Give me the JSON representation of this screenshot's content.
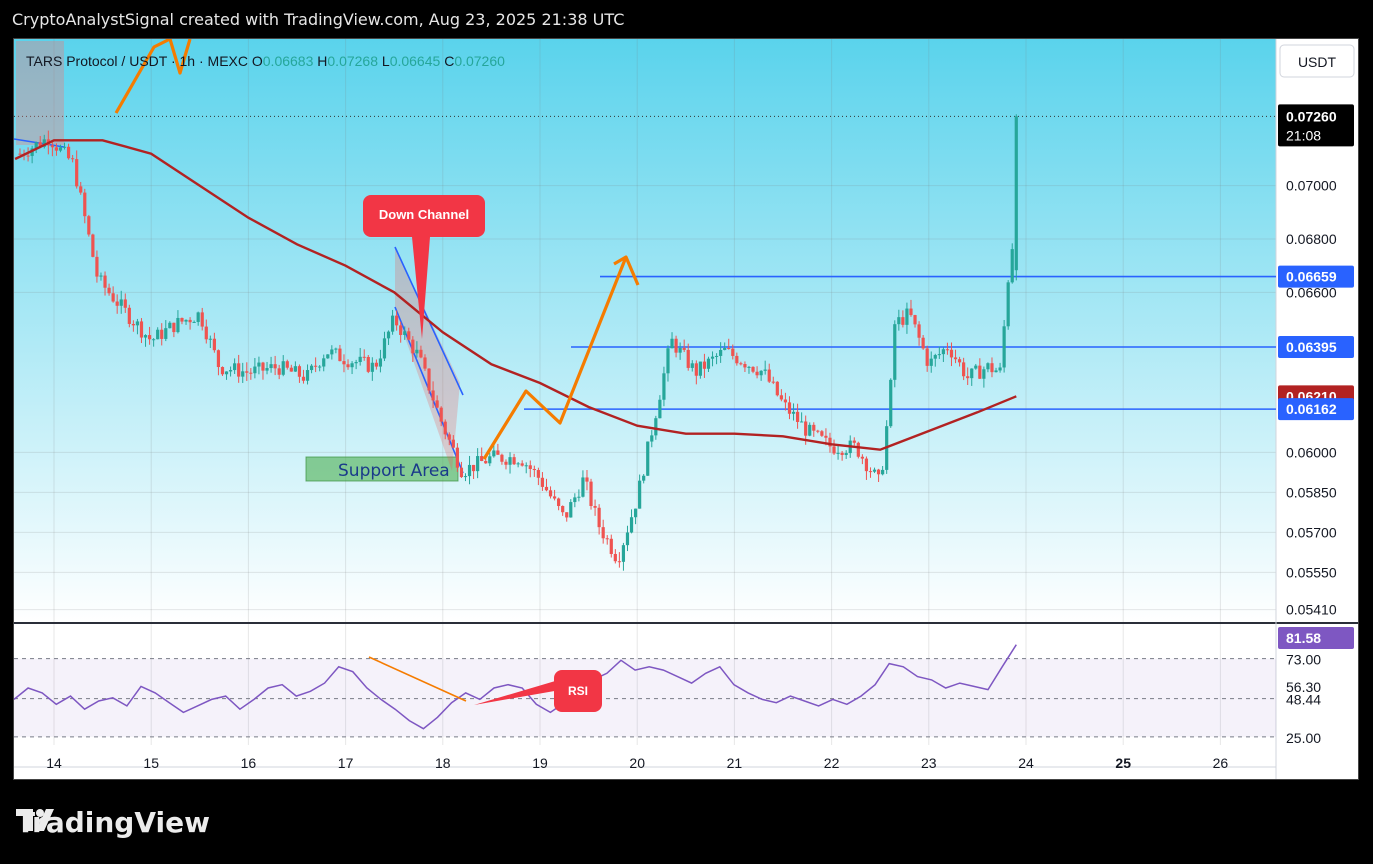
{
  "header": {
    "text": "CryptoAnalystSignal created with TradingView.com, Aug 23, 2025 21:38 UTC"
  },
  "brand": {
    "logo_text": "TradingView"
  },
  "legend": {
    "symbol": "TARS Protocol / USDT · 1h · MEXC",
    "o_label": "O",
    "o_value": "0.06683",
    "h_label": "H",
    "h_value": "0.07268",
    "l_label": "L",
    "l_value": "0.06645",
    "c_label": "C",
    "c_value": "0.07260"
  },
  "currency_button": "USDT",
  "price_labels": {
    "last": "0.07260",
    "countdown": "21:08",
    "line1": "0.06659",
    "line2": "0.06395",
    "ma": "0.06210",
    "line3": "0.06162"
  },
  "rsi_labels": {
    "current": "81.58",
    "upper": "73.00",
    "mid": "56.30",
    "mid2": "48.44",
    "lower": "25.00"
  },
  "annotations": {
    "down_channel": "Down Channel",
    "support_area": "Support Area",
    "rsi": "RSI"
  },
  "colors": {
    "up": "#26a69a",
    "down": "#ef5350",
    "ma": "#b22222",
    "levels": "#2962ff",
    "rsi": "#7e57c2",
    "arrow": "#f57c00",
    "bg_top": "#5ad3ec",
    "bg_bottom": "#ffffff"
  },
  "chart_data": {
    "type": "candlestick",
    "title": "TARS Protocol / USDT · 1h · MEXC",
    "x_ticks": [
      "14",
      "15",
      "16",
      "17",
      "18",
      "19",
      "20",
      "21",
      "22",
      "23",
      "24",
      "25",
      "26"
    ],
    "y_ticks": [
      0.07,
      0.068,
      0.066,
      0.06,
      0.0585,
      0.057,
      0.0555,
      0.0541
    ],
    "ylim": [
      0.0536,
      0.0755
    ],
    "horizontal_levels": [
      0.06659,
      0.06395,
      0.06162
    ],
    "ma_last": 0.0621,
    "last_price": 0.0726,
    "close_path": [
      {
        "x": 13.65,
        "y": 0.0712
      },
      {
        "x": 13.95,
        "y": 0.0718
      },
      {
        "x": 14.2,
        "y": 0.0708
      },
      {
        "x": 14.45,
        "y": 0.0665
      },
      {
        "x": 14.75,
        "y": 0.0652
      },
      {
        "x": 15.0,
        "y": 0.0642
      },
      {
        "x": 15.25,
        "y": 0.0648
      },
      {
        "x": 15.5,
        "y": 0.0652
      },
      {
        "x": 15.7,
        "y": 0.0632
      },
      {
        "x": 16.0,
        "y": 0.063
      },
      {
        "x": 16.3,
        "y": 0.0632
      },
      {
        "x": 16.6,
        "y": 0.0628
      },
      {
        "x": 16.8,
        "y": 0.0638
      },
      {
        "x": 17.0,
        "y": 0.0635
      },
      {
        "x": 17.3,
        "y": 0.0632
      },
      {
        "x": 17.5,
        "y": 0.065
      },
      {
        "x": 17.75,
        "y": 0.0636
      },
      {
        "x": 18.0,
        "y": 0.061
      },
      {
        "x": 18.2,
        "y": 0.0593
      },
      {
        "x": 18.5,
        "y": 0.0598
      },
      {
        "x": 18.8,
        "y": 0.0598
      },
      {
        "x": 19.0,
        "y": 0.059
      },
      {
        "x": 19.25,
        "y": 0.0575
      },
      {
        "x": 19.45,
        "y": 0.059
      },
      {
        "x": 19.6,
        "y": 0.0573
      },
      {
        "x": 19.8,
        "y": 0.056
      },
      {
        "x": 20.0,
        "y": 0.0583
      },
      {
        "x": 20.15,
        "y": 0.0608
      },
      {
        "x": 20.35,
        "y": 0.0642
      },
      {
        "x": 20.6,
        "y": 0.063
      },
      {
        "x": 20.9,
        "y": 0.0638
      },
      {
        "x": 21.1,
        "y": 0.0634
      },
      {
        "x": 21.3,
        "y": 0.063
      },
      {
        "x": 21.5,
        "y": 0.0618
      },
      {
        "x": 21.75,
        "y": 0.0608
      },
      {
        "x": 22.0,
        "y": 0.0602
      },
      {
        "x": 22.25,
        "y": 0.0602
      },
      {
        "x": 22.5,
        "y": 0.0588
      },
      {
        "x": 22.6,
        "y": 0.062
      },
      {
        "x": 22.65,
        "y": 0.0648
      },
      {
        "x": 22.8,
        "y": 0.0652
      },
      {
        "x": 23.0,
        "y": 0.0633
      },
      {
        "x": 23.2,
        "y": 0.064
      },
      {
        "x": 23.4,
        "y": 0.0628
      },
      {
        "x": 23.6,
        "y": 0.0632
      },
      {
        "x": 23.75,
        "y": 0.063
      },
      {
        "x": 23.8,
        "y": 0.0664
      },
      {
        "x": 23.85,
        "y": 0.0668
      },
      {
        "x": 23.9,
        "y": 0.0726
      }
    ],
    "ma_path": [
      {
        "x": 13.6,
        "y": 0.071
      },
      {
        "x": 14.0,
        "y": 0.0717
      },
      {
        "x": 14.5,
        "y": 0.0717
      },
      {
        "x": 15.0,
        "y": 0.0712
      },
      {
        "x": 15.5,
        "y": 0.07
      },
      {
        "x": 16.0,
        "y": 0.0688
      },
      {
        "x": 16.5,
        "y": 0.0678
      },
      {
        "x": 17.0,
        "y": 0.067
      },
      {
        "x": 17.5,
        "y": 0.066
      },
      {
        "x": 18.0,
        "y": 0.0645
      },
      {
        "x": 18.5,
        "y": 0.0633
      },
      {
        "x": 19.0,
        "y": 0.0626
      },
      {
        "x": 19.5,
        "y": 0.0617
      },
      {
        "x": 20.0,
        "y": 0.061
      },
      {
        "x": 20.5,
        "y": 0.0607
      },
      {
        "x": 21.0,
        "y": 0.0607
      },
      {
        "x": 21.5,
        "y": 0.0606
      },
      {
        "x": 22.0,
        "y": 0.0603
      },
      {
        "x": 22.5,
        "y": 0.0601
      },
      {
        "x": 23.0,
        "y": 0.0608
      },
      {
        "x": 23.5,
        "y": 0.0615
      },
      {
        "x": 23.9,
        "y": 0.0621
      }
    ],
    "rsi_series": [
      48,
      55,
      52,
      45,
      50,
      42,
      47,
      49,
      44,
      56,
      52,
      46,
      40,
      44,
      48,
      50,
      42,
      48,
      55,
      57,
      50,
      53,
      58,
      68,
      65,
      55,
      48,
      42,
      35,
      30,
      37,
      46,
      52,
      48,
      55,
      57,
      55,
      45,
      40,
      46,
      55,
      60,
      64,
      72,
      66,
      68,
      66,
      62,
      58,
      64,
      68,
      57,
      52,
      48,
      46,
      50,
      47,
      44,
      48,
      45,
      50,
      57,
      70,
      68,
      62,
      60,
      55,
      58,
      56,
      54,
      68,
      81.58
    ],
    "rsi_ylim": [
      20,
      90
    ],
    "rsi_levels": [
      73.0,
      56.3,
      48.44,
      25.0
    ]
  }
}
